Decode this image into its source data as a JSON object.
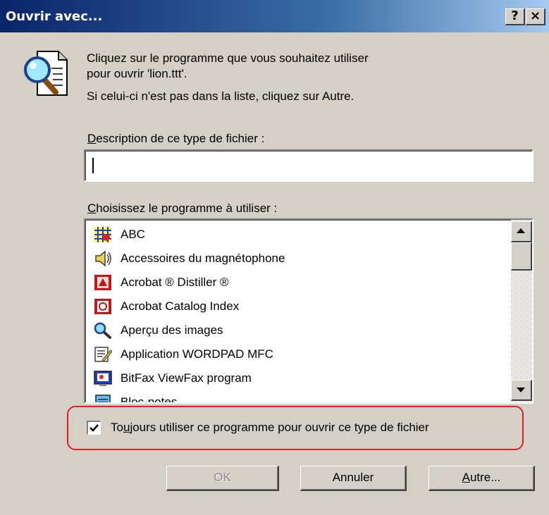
{
  "window": {
    "title": "Ouvrir avec...",
    "help_label": "?",
    "close_label": "×"
  },
  "instructions": {
    "line1": "Cliquez sur le programme que vous souhaitez utiliser",
    "line2": "pour ouvrir 'lion.ttt'.",
    "line3": "Si celui-ci n'est pas dans la liste, cliquez sur Autre."
  },
  "description": {
    "label_mnemonic": "D",
    "label_rest": "escription de ce type de fichier :",
    "value": ""
  },
  "program_list": {
    "label_mnemonic": "C",
    "label_rest": "hoisissez le programme à utiliser :",
    "items": [
      {
        "label": "ABC",
        "icon": "abc-app-icon"
      },
      {
        "label": "Accessoires du magnétophone",
        "icon": "speaker-icon"
      },
      {
        "label": "Acrobat ® Distiller ®",
        "icon": "acrobat-distiller-icon"
      },
      {
        "label": "Acrobat Catalog Index",
        "icon": "acrobat-catalog-icon"
      },
      {
        "label": "Aperçu des images",
        "icon": "magnifier-icon"
      },
      {
        "label": "Application WORDPAD MFC",
        "icon": "wordpad-icon"
      },
      {
        "label": "BitFax ViewFax program",
        "icon": "fax-viewer-icon"
      },
      {
        "label": "Bloc-notes",
        "icon": "notepad-icon"
      }
    ]
  },
  "always_use": {
    "checked": true,
    "label_before": "To",
    "label_mnemonic": "u",
    "label_after": "jours utiliser ce programme pour ouvrir ce type de fichier"
  },
  "buttons": {
    "ok": "OK",
    "cancel": "Annuler",
    "other_mnemonic": "A",
    "other_rest": "utre..."
  },
  "colors": {
    "titlebar_start": "#0a246a",
    "titlebar_end": "#a6caf0",
    "dialog_face": "#d4d0c8",
    "highlight_outline": "#e02020"
  }
}
